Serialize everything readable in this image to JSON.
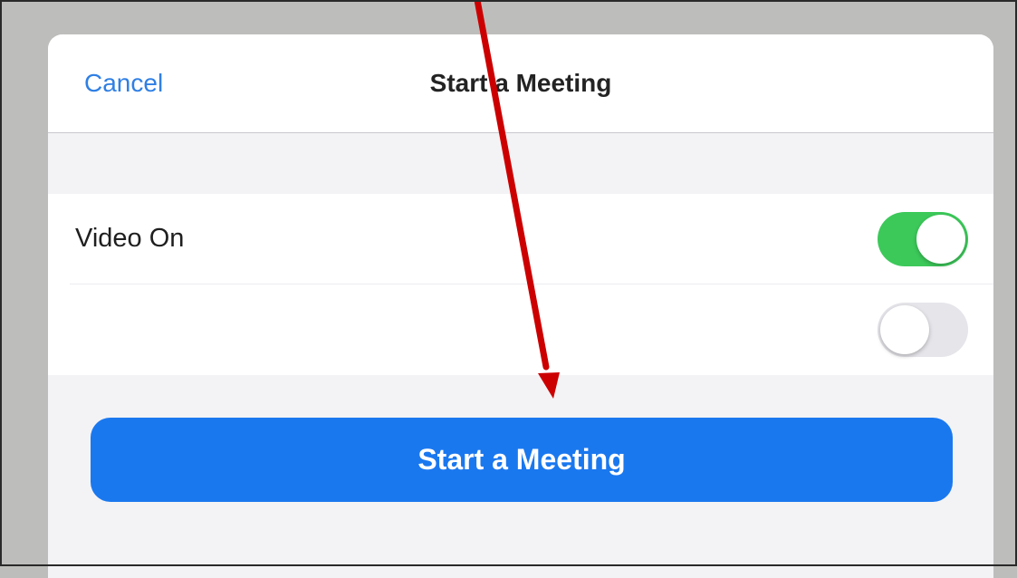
{
  "header": {
    "cancel_label": "Cancel",
    "title": "Start a Meeting"
  },
  "settings": [
    {
      "label": "Video On",
      "enabled": true
    },
    {
      "label": "",
      "enabled": false
    }
  ],
  "start_button": {
    "label": "Start a Meeting"
  },
  "colors": {
    "accent": "#1a78ef",
    "toggle_on": "#3cc95a",
    "toggle_off": "#e5e5ea",
    "arrow": "#cc0000"
  }
}
